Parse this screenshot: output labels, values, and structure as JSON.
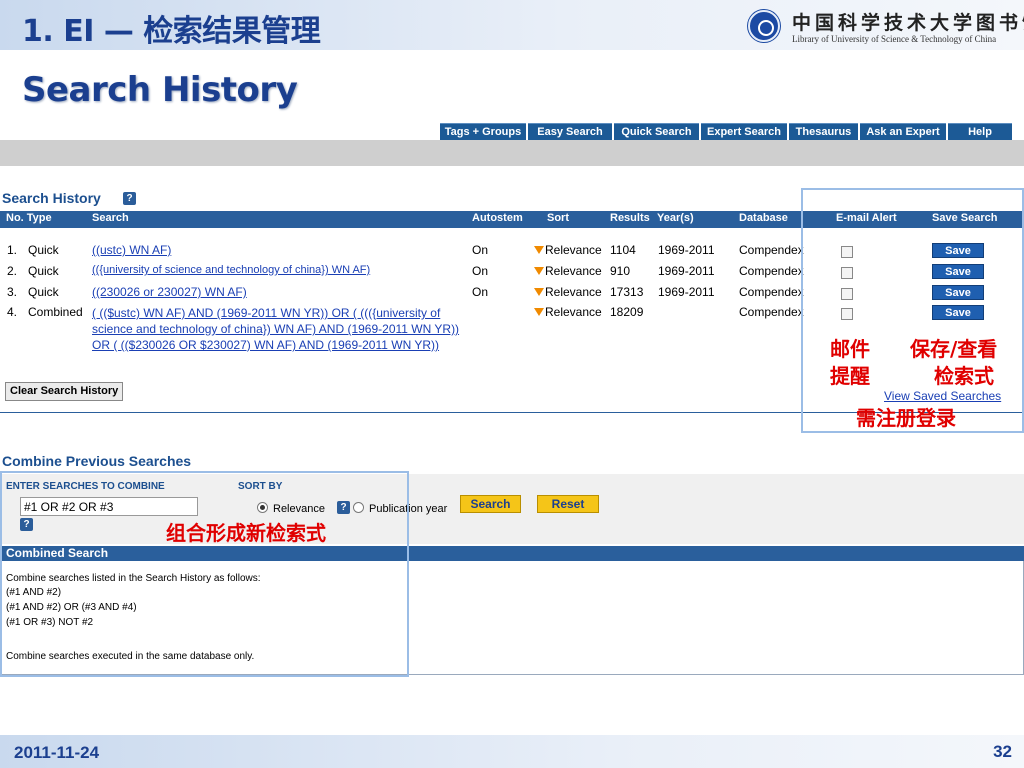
{
  "slide": {
    "title": "1. EI — 检索结果管理",
    "heading": "Search History",
    "logo_cn": "中国科学技术大学图书馆",
    "logo_en": "Library of University of Science & Technology of China",
    "date": "2011-11-24",
    "page": "32"
  },
  "nav": {
    "tabs": [
      "Tags + Groups",
      "Easy Search",
      "Quick Search",
      "Expert Search",
      "Thesaurus",
      "Ask an Expert",
      "Help"
    ]
  },
  "history": {
    "title": "Search History",
    "help": "?",
    "columns": {
      "no_type": "No. Type",
      "search": "Search",
      "autostem": "Autostem",
      "sort": "Sort",
      "results": "Results",
      "years": "Year(s)",
      "database": "Database",
      "alert": "E-mail Alert",
      "save": "Save Search"
    },
    "rows": [
      {
        "no": "1.",
        "type": "Quick",
        "search": "((ustc) WN AF)",
        "autostem": "On",
        "sort": "Relevance",
        "results": "1104",
        "years": "1969-2011",
        "database": "Compendex",
        "save": "Save"
      },
      {
        "no": "2.",
        "type": "Quick",
        "search": "(({university of science and technology of china}) WN AF)",
        "autostem": "On",
        "sort": "Relevance",
        "results": "910",
        "years": "1969-2011",
        "database": "Compendex",
        "save": "Save"
      },
      {
        "no": "3.",
        "type": "Quick",
        "search": "((230026 or 230027) WN AF)",
        "autostem": "On",
        "sort": "Relevance",
        "results": "17313",
        "years": "1969-2011",
        "database": "Compendex",
        "save": "Save"
      },
      {
        "no": "4.",
        "type": "Combined",
        "search": "( (($ustc) WN AF) AND (1969-2011 WN YR)) OR ( ((({university of science and technology of china}) WN AF) AND (1969-2011 WN YR)) OR ( (($230026 OR $230027) WN AF) AND (1969-2011 WN YR))",
        "autostem": "",
        "sort": "Relevance",
        "results": "18209",
        "years": "",
        "database": "Compendex",
        "save": "Save"
      }
    ],
    "clear_label": "Clear Search History",
    "view_saved": "View Saved Searches"
  },
  "annotations": {
    "alert_line1": "邮件",
    "alert_line2": "提醒",
    "save_line1": "保存/查看",
    "save_line2": "检索式",
    "login": "需注册登录",
    "combine": "组合形成新检索式"
  },
  "combine": {
    "title": "Combine Previous Searches",
    "enter_label": "ENTER SEARCHES TO COMBINE",
    "input_value": "#1 OR #2 OR #3",
    "sort_label": "SORT BY",
    "relevance": "Relevance",
    "publication_year": "Publication year",
    "search_btn": "Search",
    "reset_btn": "Reset",
    "help": "?"
  },
  "combined_search": {
    "title": "Combined Search",
    "intro": "Combine searches listed in the Search History as follows:",
    "ex1": "(#1 AND #2)",
    "ex2": "(#1 AND #2) OR (#3 AND #4)",
    "ex3": "(#1 OR #3) NOT #2",
    "note": "Combine searches executed in the same database only."
  }
}
